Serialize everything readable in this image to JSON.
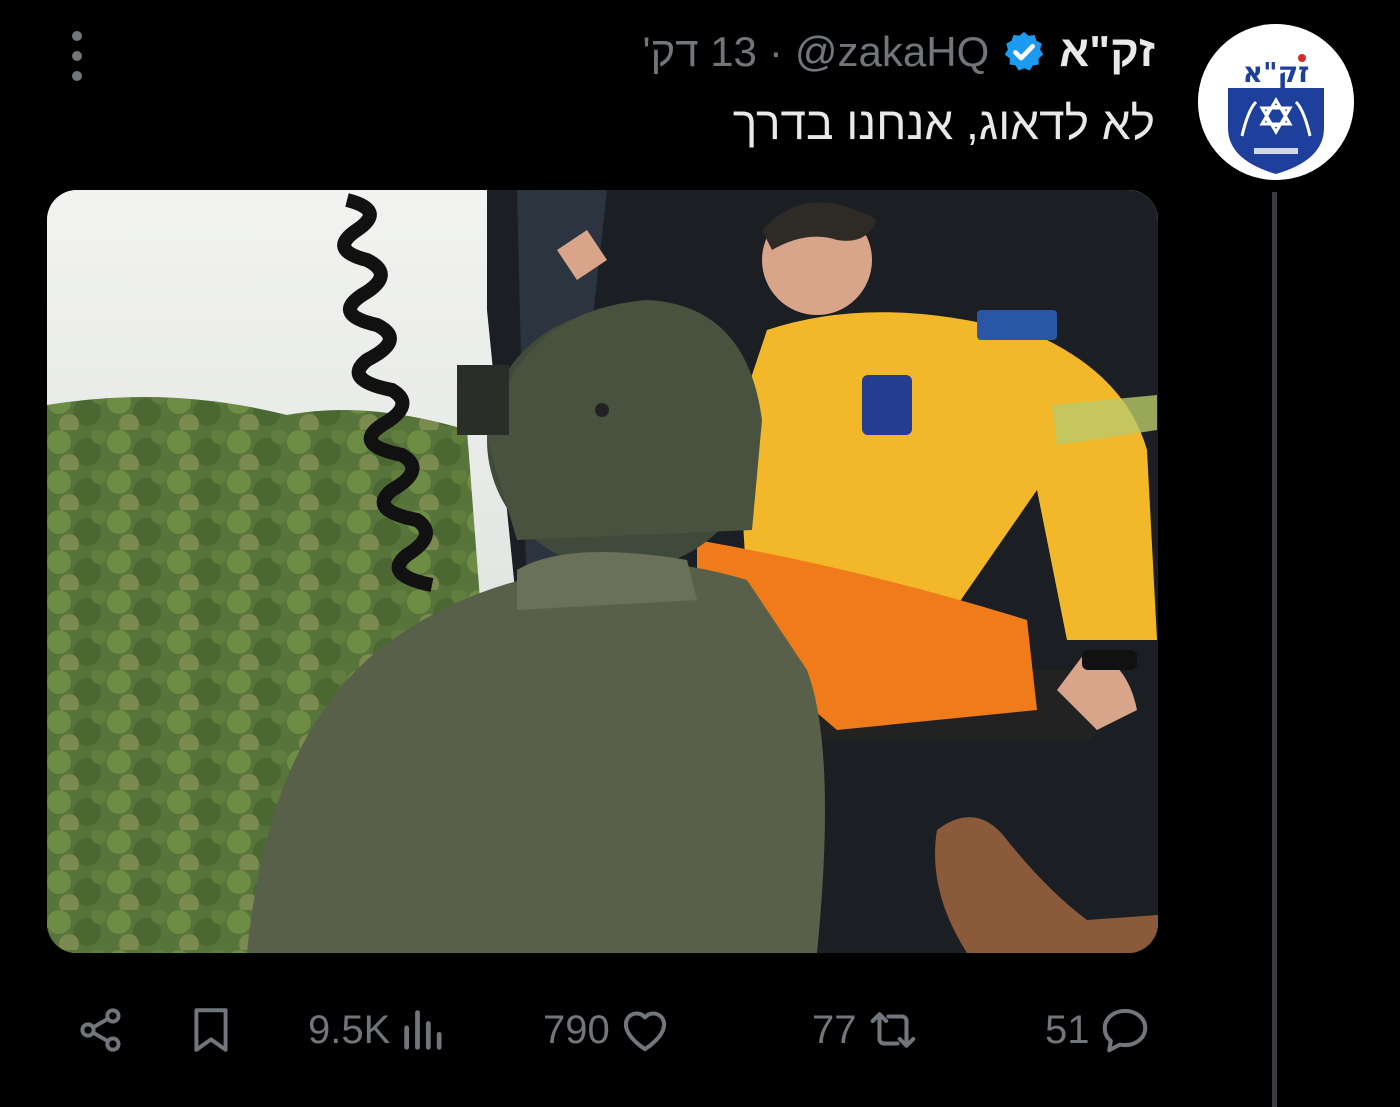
{
  "tweet": {
    "display_name": "זק\"א",
    "handle": "@zakaHQ",
    "separator": "·",
    "time": "13 דק'",
    "text": "לא לדאוג, אנחנו בדרך",
    "verified_icon": "verified-badge-icon",
    "avatar_logo_text": "זק\"א"
  },
  "actions": {
    "share_icon": "share-icon",
    "bookmark_icon": "bookmark-icon",
    "views": "9.5K",
    "views_icon": "views-chart-icon",
    "likes": "790",
    "likes_icon": "heart-icon",
    "retweets": "77",
    "retweets_icon": "retweet-icon",
    "replies": "51",
    "replies_icon": "reply-bubble-icon"
  },
  "colors": {
    "background": "#000000",
    "text_primary": "#e7e9ea",
    "text_secondary": "#71767b",
    "verified_blue": "#1d9bf0",
    "thread_line": "#3a3d40",
    "logo_blue": "#1f3f9c"
  }
}
